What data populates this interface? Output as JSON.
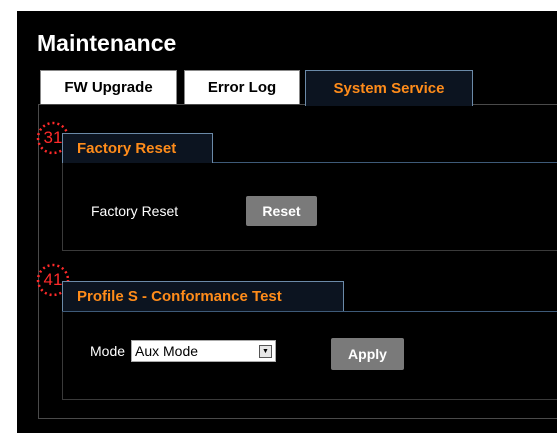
{
  "page": {
    "title": "Maintenance"
  },
  "tabs": [
    {
      "label": "FW Upgrade",
      "active": false
    },
    {
      "label": "Error Log",
      "active": false
    },
    {
      "label": "System Service",
      "active": true
    }
  ],
  "factory_reset": {
    "heading": "Factory Reset",
    "marker": "31",
    "field_label": "Factory Reset",
    "button_label": "Reset"
  },
  "conformance": {
    "heading": "Profile S - Conformance Test",
    "marker": "41",
    "mode_label": "Mode",
    "mode_value": "Aux Mode",
    "apply_label": "Apply"
  },
  "colors": {
    "accent": "#ff8c1a",
    "background": "#000000",
    "marker": "#ff2a2a",
    "button": "#7a7a7a"
  }
}
